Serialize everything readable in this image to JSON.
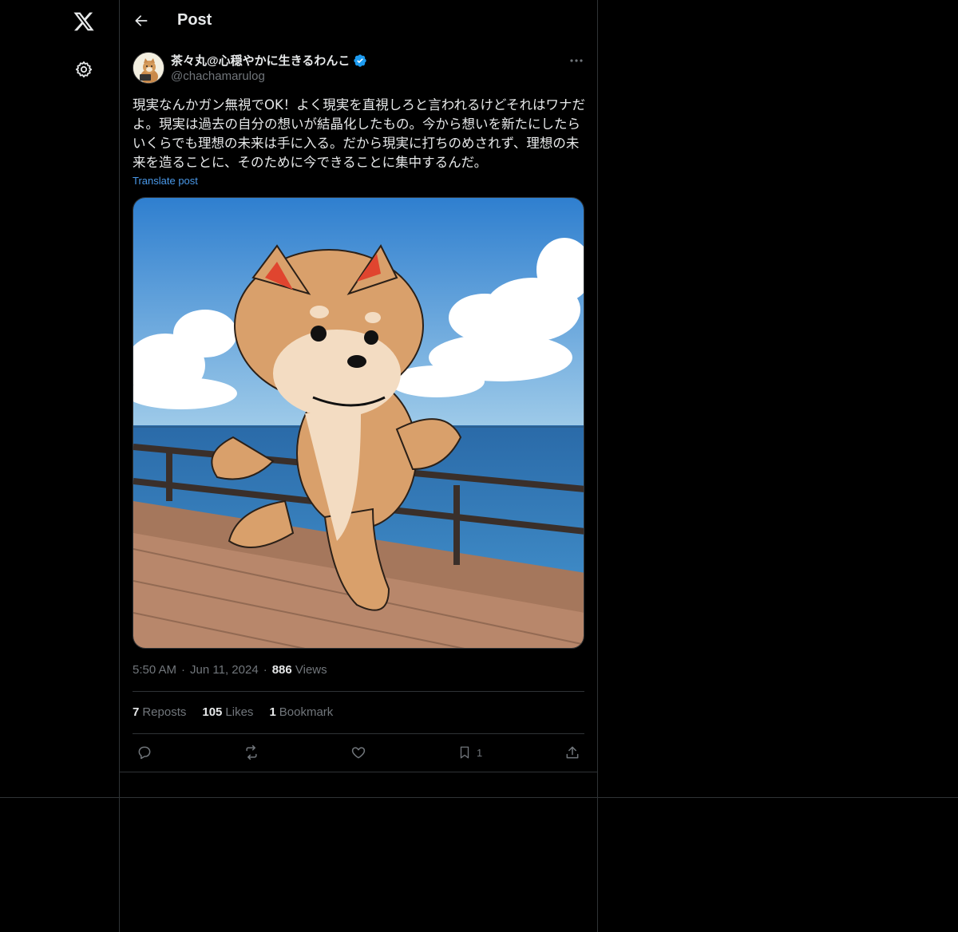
{
  "header": {
    "title": "Post",
    "back_icon": "arrow-left-icon"
  },
  "left_rail": {
    "logo_icon": "x-logo-icon",
    "settings_icon": "gear-icon"
  },
  "post": {
    "author": {
      "display_name": "茶々丸@心穏やかに生きるわんこ",
      "handle": "@chachamarulog",
      "verified": true,
      "verified_color": "#1d9bf0"
    },
    "text": "現実なんかガン無視でOK！よく現実を直視しろと言われるけどそれはワナだよ。現実は過去の自分の想いが結晶化したもの。今から想いを新たにしたらいくらでも理想の未来は手に入る。だから現実に打ちのめされず、理想の未来を造ることに、そのために今できることに集中するんだ。",
    "translate_label": "Translate post",
    "time": "5:50 AM",
    "date": "Jun 11, 2024",
    "views_count": "886",
    "views_label": "Views",
    "stats": {
      "reposts_count": "7",
      "reposts_label": "Reposts",
      "likes_count": "105",
      "likes_label": "Likes",
      "bookmarks_count": "1",
      "bookmarks_label": "Bookmark"
    },
    "actions": {
      "reply_icon": "reply-icon",
      "repost_icon": "repost-icon",
      "like_icon": "heart-icon",
      "bookmark_icon": "bookmark-icon",
      "bookmark_count": "1",
      "share_icon": "share-icon"
    }
  },
  "colors": {
    "background": "#000000",
    "text_primary": "#e7e9ea",
    "text_secondary": "#71767b",
    "link": "#4a99e9",
    "border": "#2f3336"
  }
}
